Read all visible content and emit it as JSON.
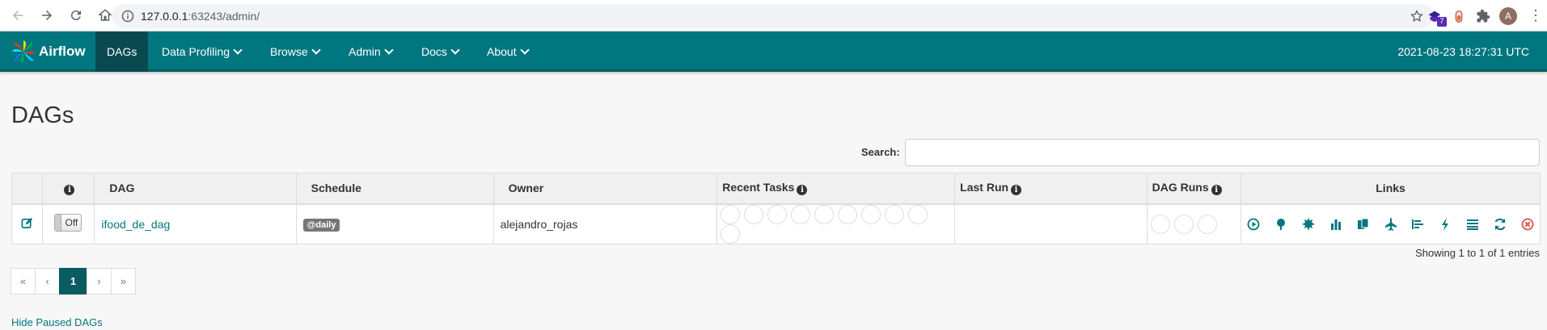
{
  "browser": {
    "url_host": "127.0.0.1",
    "url_rest": ":63243/admin/",
    "ext_badge": "7",
    "avatar_letter": "A"
  },
  "navbar": {
    "brand": "Airflow",
    "items": [
      {
        "label": "DAGs",
        "active": true
      },
      {
        "label": "Data Profiling",
        "dropdown": true
      },
      {
        "label": "Browse",
        "dropdown": true
      },
      {
        "label": "Admin",
        "dropdown": true
      },
      {
        "label": "Docs",
        "dropdown": true
      },
      {
        "label": "About",
        "dropdown": true
      }
    ],
    "timestamp": "2021-08-23 18:27:31 UTC"
  },
  "page": {
    "title": "DAGs",
    "search_label": "Search:",
    "search_value": ""
  },
  "table": {
    "headers": {
      "dag": "DAG",
      "schedule": "Schedule",
      "owner": "Owner",
      "recent_tasks": "Recent Tasks",
      "last_run": "Last Run",
      "dag_runs": "DAG Runs",
      "links": "Links"
    },
    "info_glyph": "i",
    "rows": [
      {
        "toggle": "Off",
        "dag": "ifood_de_dag",
        "schedule": "@daily",
        "owner": "alejandro_rojas",
        "last_run": ""
      }
    ]
  },
  "footer": {
    "showing": "Showing 1 to 1 of 1 entries",
    "pagination": [
      "«",
      "‹",
      "1",
      "›",
      "»"
    ],
    "active_page": "1",
    "hide_paused": "Hide Paused DAGs"
  },
  "colors": {
    "navbar": "#00767f",
    "navbar_active": "#0a4950",
    "link": "#00767f",
    "delete": "#d9534f"
  }
}
